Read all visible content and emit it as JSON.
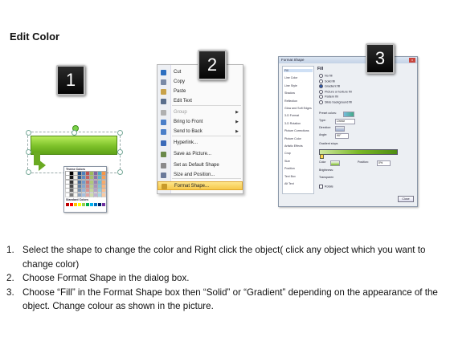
{
  "title": "Edit Color",
  "badges": [
    "1",
    "2",
    "3"
  ],
  "context_menu": {
    "items": [
      {
        "label": "Cut",
        "icon": "scissors-icon",
        "color": "#2d6fc0"
      },
      {
        "label": "Copy",
        "icon": "copy-icon",
        "color": "#7a8aa6"
      },
      {
        "label": "Paste",
        "icon": "paste-icon",
        "color": "#c8a24a"
      },
      {
        "label": "Edit Text",
        "icon": "edit-text-icon",
        "color": "#5a6e8c"
      },
      {
        "label": "Group",
        "icon": "group-icon",
        "color": "#b0b0b0",
        "submenu": true,
        "disabled": true
      },
      {
        "label": "Bring to Front",
        "icon": "bring-front-icon",
        "color": "#4a7fc8",
        "submenu": true
      },
      {
        "label": "Send to Back",
        "icon": "send-back-icon",
        "color": "#4a7fc8",
        "submenu": true
      },
      {
        "label": "Hyperlink...",
        "icon": "hyperlink-icon",
        "color": "#3a6ab8"
      },
      {
        "label": "Save as Picture...",
        "icon": "picture-icon",
        "color": "#6a8a4a"
      },
      {
        "label": "Set as Default Shape",
        "icon": "default-shape-icon",
        "color": "#8a8a8a"
      },
      {
        "label": "Size and Position...",
        "icon": "size-position-icon",
        "color": "#6a7a9a"
      },
      {
        "label": "Format Shape...",
        "icon": "format-shape-icon",
        "color": "#c89a2a",
        "highlighted": true
      }
    ]
  },
  "format_dialog": {
    "title": "Format Shape",
    "close_glyph": "x",
    "categories": [
      "Fill",
      "Line Color",
      "Line Style",
      "Shadow",
      "Reflection",
      "Glow and Soft Edges",
      "3-D Format",
      "3-D Rotation",
      "Picture Corrections",
      "Picture Color",
      "Artistic Effects",
      "Crop",
      "Size",
      "Position",
      "Text Box",
      "Alt Text"
    ],
    "selected_category": "Fill",
    "heading": "Fill",
    "fill_options": [
      "No fill",
      "Solid fill",
      "Gradient fill",
      "Picture or texture fill",
      "Pattern fill",
      "Slide background fill"
    ],
    "selected_fill": "Gradient fill",
    "preset_label": "Preset colors:",
    "type_label": "Type:",
    "type_value": "Linear",
    "direction_label": "Direction:",
    "angle_label": "Angle:",
    "angle_value": "90°",
    "gradient_label": "Gradient stops",
    "color_label": "Color",
    "position_label": "Position:",
    "position_value": "0%",
    "brightness_label": "Brightness:",
    "transparency_label": "Transparen",
    "rotate_label": "Rotate",
    "theme_colors_label": "Theme Colors",
    "standard_colors_label": "Standard Colors",
    "close_label": "Close"
  },
  "instructions": [
    {
      "num": "1.",
      "text": "Select the shape to change the color and Right click the object( click any object which you want to change color)"
    },
    {
      "num": "2.",
      "text": "Choose Format Shape in the dialog box."
    },
    {
      "num": "3.",
      "text": "Choose “Fill” in the Format Shape box then “Solid” or “Gradient” depending on the appearance of the object. Change colour as shown in the picture."
    }
  ],
  "colors": {
    "shape_green": "#7dc12a",
    "highlight": "#f6c84a",
    "badge_bg": "#0a0a0a"
  }
}
